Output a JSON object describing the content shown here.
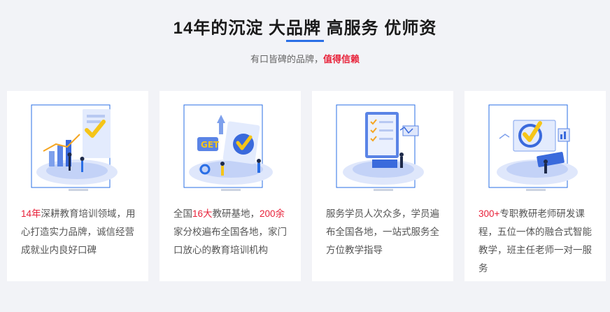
{
  "header": {
    "title": "14年的沉淀 大品牌 高服务 优师资",
    "subtitle_prefix": "有口皆碑的品牌，",
    "subtitle_highlight": "值得信赖"
  },
  "cards": [
    {
      "illustration": "growth-chart-illustration",
      "text_parts": [
        {
          "text": "14年",
          "highlight": true
        },
        {
          "text": "深耕教育培训领域，用心打造实力品牌，诚信经营成就业内良好口碑",
          "highlight": false
        }
      ]
    },
    {
      "illustration": "get-award-illustration",
      "text_parts": [
        {
          "text": "全国",
          "highlight": false
        },
        {
          "text": "16大",
          "highlight": true
        },
        {
          "text": "教研基地，",
          "highlight": false
        },
        {
          "text": "200余",
          "highlight": true
        },
        {
          "text": "家分校遍布全国各地，家门口放心的教育培训机构",
          "highlight": false
        }
      ]
    },
    {
      "illustration": "checklist-service-illustration",
      "text_parts": [
        {
          "text": "服务学员人次众多，学员遍布全国各地，一站式服务全方位教学指导",
          "highlight": false
        }
      ]
    },
    {
      "illustration": "laptop-teaching-illustration",
      "text_parts": [
        {
          "text": "300+",
          "highlight": true
        },
        {
          "text": "专职教研老师研发课程，五位一体的融合式智能教学，班主任老师一对一服务",
          "highlight": false
        }
      ]
    }
  ],
  "colors": {
    "accent_blue": "#2a6fe6",
    "highlight_red": "#e8223a",
    "background": "#f2f3f7"
  }
}
